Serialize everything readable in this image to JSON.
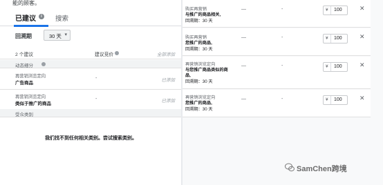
{
  "top_cut_text": "能的顾客。",
  "tabs": {
    "suggested": "已建议",
    "search": "搜索"
  },
  "period": {
    "label": "回溯期",
    "value": "30 天"
  },
  "list_header": {
    "count": "2 个建议",
    "bid": "建议竞价",
    "add_all": "全部添加"
  },
  "sections": {
    "dynamic": "动态细分",
    "audience": "受众类别"
  },
  "items": [
    {
      "line1": "再营销浏览定向",
      "line2": "广告商品",
      "bid": "-",
      "status": "已添加"
    },
    {
      "line1": "再营销浏览定向",
      "line2": "类似于推广的商品",
      "bid": "-",
      "status": "已添加"
    }
  ],
  "empty_message": "我们找不到任何相关类别。尝试搜索类别。",
  "cards": [
    {
      "l1": "购买再营销",
      "l2": "与推广的商品相关,",
      "l3": "回溯期：30 天",
      "l4": "",
      "d1": "—",
      "d2": "-",
      "currency": "¥",
      "value": "100"
    },
    {
      "l1": "购买再营销",
      "l2": "您推广的商品,",
      "l3": "回溯期：30 天",
      "l4": "",
      "d1": "—",
      "d2": "-",
      "currency": "¥",
      "value": "100"
    },
    {
      "l1": "再营销浏览定向",
      "l2": "与您推广商品类似的商",
      "l3": "品,",
      "l4": "回溯期：30 天",
      "d1": "—",
      "d2": "-",
      "currency": "¥",
      "value": "100"
    },
    {
      "l1": "再营销浏览定向",
      "l2": "您推广的商品,",
      "l3": "回溯期：30 天",
      "l4": "",
      "d1": "—",
      "d2": "-",
      "currency": "¥",
      "value": "100"
    }
  ],
  "watermark": "SamChen跨境",
  "colors": {
    "accent": "#1a73e8",
    "section_bg": "#f1f3f4"
  }
}
